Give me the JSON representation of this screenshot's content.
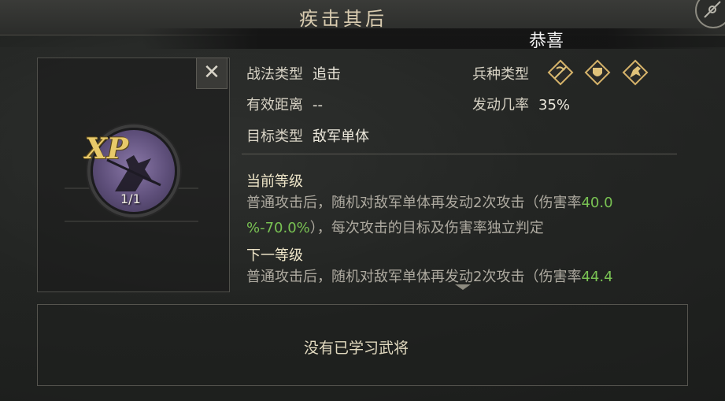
{
  "header": {
    "title": "疾击其后"
  },
  "popup": {
    "text": "恭喜"
  },
  "skill": {
    "xp_label": "XP",
    "level_count": "1/1",
    "close_symbol": "✕"
  },
  "attributes": {
    "type_label": "战法类型",
    "type_value": "追击",
    "range_label": "有效距离",
    "range_value": "--",
    "target_label": "目标类型",
    "target_value": "敌军单体",
    "troop_label": "兵种类型",
    "rate_label": "发动几率",
    "rate_value": "35%",
    "troop_icons": [
      "archer-troop-icon",
      "shield-troop-icon",
      "cavalry-troop-icon"
    ]
  },
  "current_level": {
    "heading": "当前等级",
    "line1_prefix": "普通攻击后，随机对敌军单体再发动2次攻击（伤害率",
    "line1_green": "40.0",
    "line2_green": "%-70.0%",
    "line2_suffix": "），每次攻击的目标及伤害率独立判定"
  },
  "next_level": {
    "heading": "下一等级",
    "line1_prefix": "普通攻击后，随机对敌军单体再发动2次攻击（伤害率",
    "line1_green": "44.4"
  },
  "generals": {
    "empty_text": "没有已学习武将"
  },
  "colors": {
    "highlight_green": "#79c253",
    "gold": "#e8c96a"
  }
}
